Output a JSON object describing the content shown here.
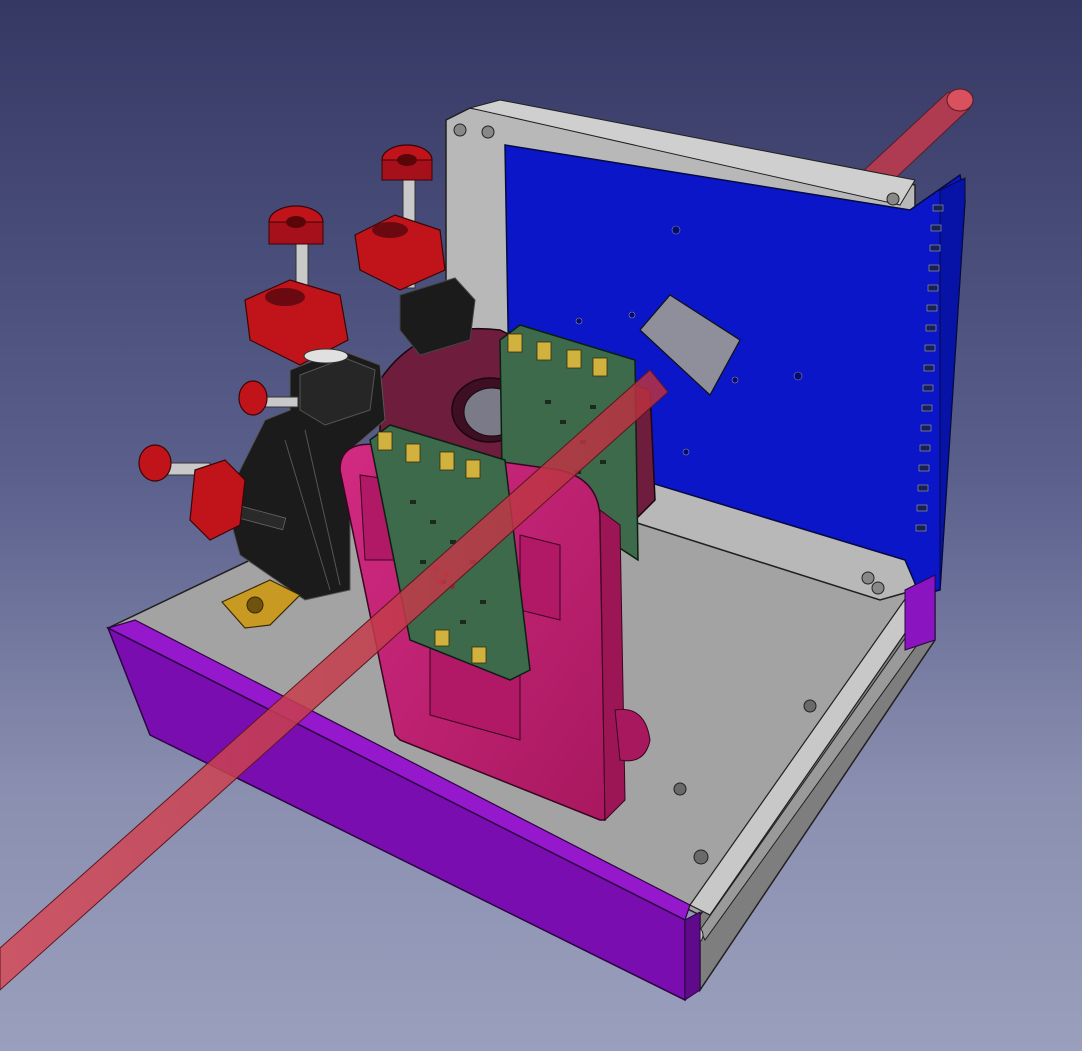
{
  "viewport": {
    "background_top": "#353863",
    "background_bottom": "#9a9fbd"
  },
  "parts": {
    "base_plate_color": "#a9a9a9",
    "front_rail_color": "#7a0db0",
    "side_rail_color": "#8c8c8c",
    "back_frame_color": "#b9b9b9",
    "blue_board_color": "#0a16c8",
    "pink_holder_color": "#c41f73",
    "maroon_mount_color": "#6e1d3d",
    "pcb_color": "#3c6a4b",
    "connector_color": "#d1b23f",
    "black_stage_color": "#1b1b1b",
    "red_knob_color": "#c0141a",
    "gold_clamp_color": "#c89a22",
    "laser_beam_color": "#c83a4a"
  },
  "icons": {
    "model": "cad-assembly-icon"
  }
}
